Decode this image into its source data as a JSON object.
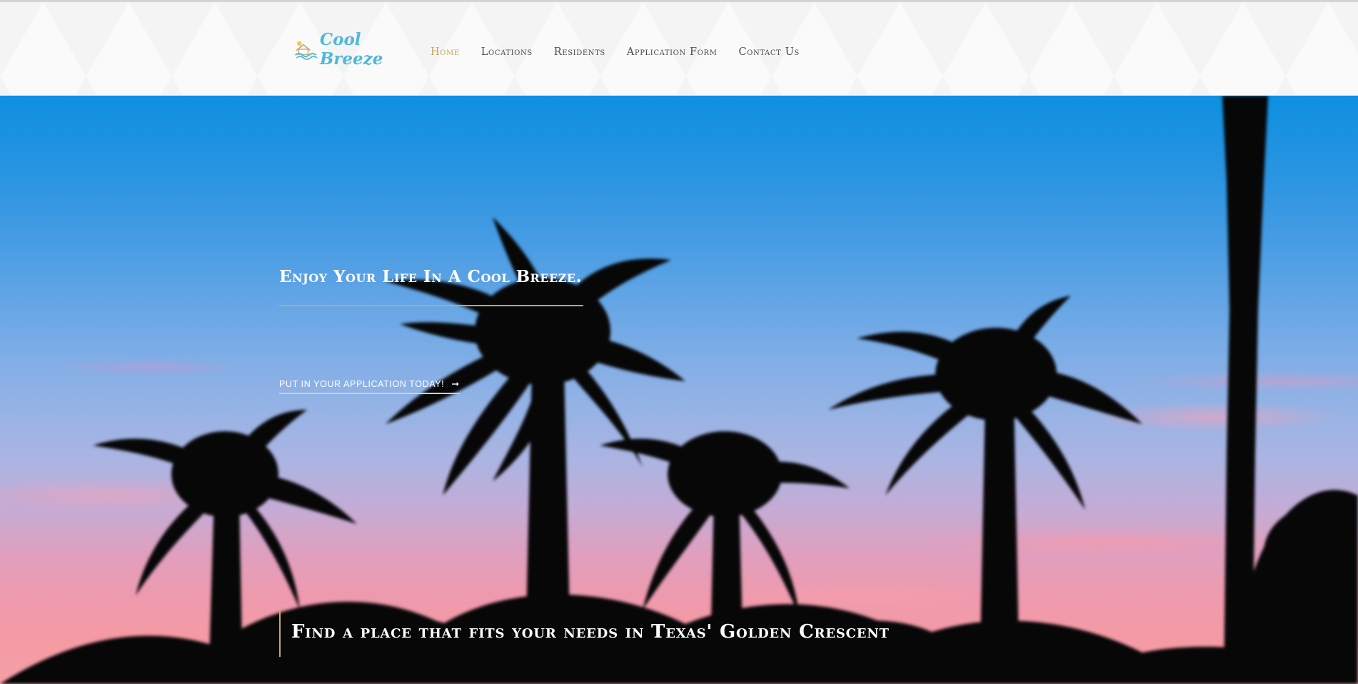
{
  "brand": {
    "name": "Cool Breeze",
    "logo_icon": "house-waves-logo-icon",
    "accent_color": "#4fb8dc",
    "gold_color": "#c8a55c"
  },
  "nav": {
    "items": [
      {
        "label": "Home",
        "active": true
      },
      {
        "label": "Locations",
        "active": false
      },
      {
        "label": "Residents",
        "active": false
      },
      {
        "label": "Application Form",
        "active": false
      },
      {
        "label": "Contact Us",
        "active": false
      }
    ]
  },
  "hero": {
    "title": "Enjoy Your Life In A Cool Breeze.",
    "cta_label": "PUT IN YOUR APPLICATION TODAY!",
    "cta_icon": "arrow-right-icon",
    "cta_arrow": "➞",
    "tagline": "Find a place that fits your needs in Texas' Golden Crescent",
    "background": "palm-trees-sunset-image"
  }
}
